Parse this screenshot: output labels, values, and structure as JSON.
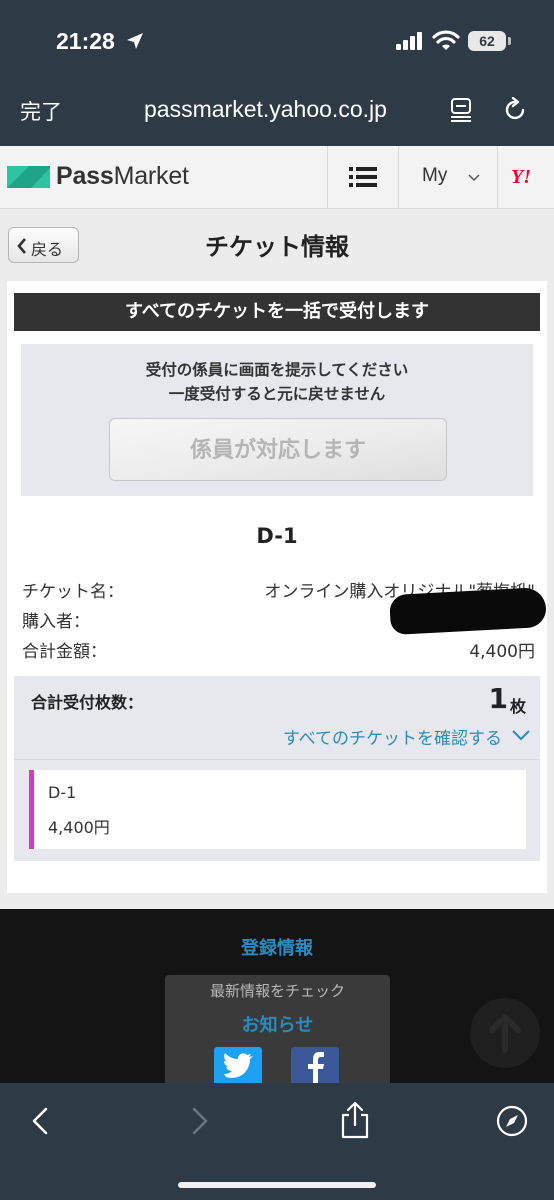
{
  "status_bar": {
    "time": "21:28",
    "battery": "62"
  },
  "browser": {
    "done_label": "完了",
    "url": "passmarket.yahoo.co.jp"
  },
  "site_header": {
    "logo_bold": "Pass",
    "logo_light": "Market",
    "my_label": "My",
    "yahoo_label": "Y!"
  },
  "page": {
    "back_label": "戻る",
    "title": "チケット情報",
    "bulk_receive_banner": "すべてのチケットを一括で受付します",
    "instruction_line1": "受付の係員に画面を提示してください",
    "instruction_line2": "一度受付すると元に戻せません",
    "staff_button_label": "係員が対応します",
    "ticket_code": "D-1",
    "details": {
      "ticket_name_label": "チケット名：",
      "ticket_name_value": "オンライン購入オリジナル\"葱塩枡\"",
      "purchaser_label": "購入者：",
      "total_price_label": "合計金額：",
      "total_price_value": "4,400円"
    },
    "summary": {
      "total_count_label": "合計受付枚数：",
      "total_count": "1",
      "total_count_unit": "枚",
      "view_all_link": "すべてのチケットを確認する"
    },
    "tickets": [
      {
        "code": "D-1",
        "price": "4,400円",
        "accent_color": "#d63bbf"
      }
    ]
  },
  "footer": {
    "registration_info": "登録情報",
    "news_subtitle": "最新情報をチェック",
    "news_title": "お知らせ",
    "social_icons": [
      "twitter-icon",
      "facebook-icon"
    ]
  },
  "colors": {
    "link": "#2a8bbf",
    "chrome": "#2f3a47",
    "logo_green": "#2ec4a0",
    "yahoo_red": "#ff0033"
  }
}
